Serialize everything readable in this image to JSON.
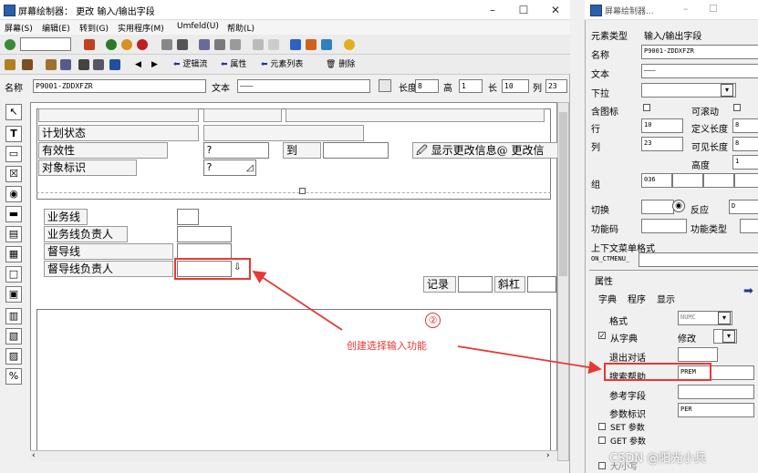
{
  "main_window": {
    "title": "屏幕绘制器： 更改 输入/输出字段",
    "minimize": "–",
    "maximize": "☐",
    "close": "✕",
    "menu": [
      "屏幕(S)",
      "编辑(E)",
      "转到(G)",
      "实用程序(M)",
      "Umfeld(U)",
      "帮助(L)"
    ],
    "toolbar2": {
      "logic_flow": "逻辑流",
      "attributes": "属性",
      "element_list": "元素列表",
      "delete": "删除"
    },
    "name_bar": {
      "name_label": "名称",
      "name_value": "P9001-ZDDXFZR",
      "text_label": "文本",
      "text_value": "———",
      "length_label": "长度",
      "length_value": "8",
      "height_label": "高",
      "height_value": "1",
      "len2_label": "长",
      "len2_value": "10",
      "col_label": "列",
      "col_value": "23"
    },
    "canvas": {
      "plan_status": "计划状态",
      "validity": "有效性",
      "input_q1": "?",
      "to": "到",
      "show_change_info": "显示更改信息@",
      "change_info": "更改信",
      "object_id": "对象标识",
      "input_q2": "?",
      "business_line": "业务线",
      "business_line_owner": "业务线负责人",
      "supervision_line": "督导线",
      "supervision_line_owner": "督导线负责人",
      "record": "记录",
      "italic": "斜杠"
    },
    "annotation": {
      "number": "②",
      "text": "创建选择输入功能"
    }
  },
  "attr_window": {
    "title": "屏幕绘制器...",
    "element_type_label": "元素类型",
    "element_type_value": "输入/输出字段",
    "name_label": "名称",
    "name_value": "P9001-ZDDXFZR",
    "text_label": "文本",
    "text_value": "———",
    "dropdown_label": "下拉",
    "with_icon_label": "含图标",
    "scrollable_label": "可滚动",
    "row_label": "行",
    "row_value": "10",
    "def_length_label": "定义长度",
    "def_length_value": "8",
    "col_label": "列",
    "col_value": "23",
    "vis_length_label": "可见长度",
    "vis_length_value": "8",
    "height_label": "高度",
    "height_value": "1",
    "group_label": "组",
    "group_value": "036",
    "switch_label": "切换",
    "respond_label": "反应",
    "respond_value": "D",
    "func_code_label": "功能码",
    "func_type_label": "功能类型",
    "context_menu_label": "上下文菜单格式",
    "context_menu_value": "ON_CTMENU_",
    "properties_label": "属性",
    "tabs": [
      "字典",
      "程序",
      "显示"
    ],
    "format_label": "格式",
    "format_value": "NUMC",
    "from_dict_label": "从字典",
    "modify_label": "修改",
    "exit_dialog_label": "退出对话",
    "search_help_label": "搜索帮助",
    "search_help_value": "PREM",
    "ref_field_label": "参考字段",
    "param_id_label": "参数标识",
    "param_id_value": "PER",
    "set_param_label": "SET 参数",
    "get_param_label": "GET 参数",
    "lower_label": "大/小写"
  },
  "watermark": "CSDN @阳光小兵",
  "colors": {
    "annotation": "#e53935",
    "title_icon": "#2f5ea8"
  }
}
